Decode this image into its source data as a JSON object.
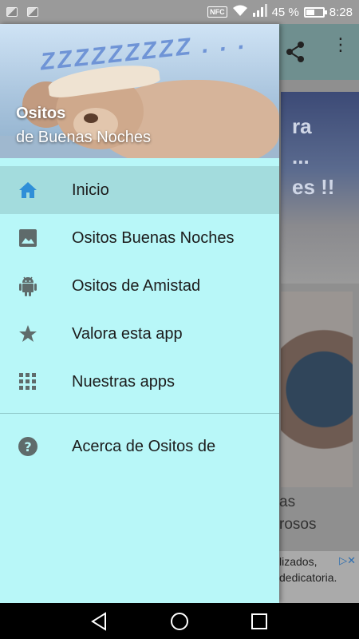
{
  "status_bar": {
    "nfc_label": "NFC",
    "battery_text": "45 %",
    "battery_level": 0.45,
    "time": "8:28"
  },
  "background_app": {
    "card1_text": "ra\n...\nes !!",
    "card2_text": "as\nrosos",
    "ad_text": "lizados,\ndedicatoria."
  },
  "drawer": {
    "header": {
      "title": "Ositos",
      "subtitle": "de Buenas Noches",
      "image_text": "ZZZZZZZZZ . . ."
    },
    "items": [
      {
        "label": "Inicio",
        "icon": "home-icon",
        "active": true
      },
      {
        "label": "Ositos Buenas Noches",
        "icon": "image-icon",
        "active": false
      },
      {
        "label": "Ositos de Amistad",
        "icon": "android-icon",
        "active": false
      },
      {
        "label": "Valora esta app",
        "icon": "star-icon",
        "active": false
      },
      {
        "label": "Nuestras apps",
        "icon": "apps-grid-icon",
        "active": false
      },
      {
        "label": "Acerca de Ositos de",
        "icon": "help-icon",
        "active": false
      }
    ]
  },
  "colors": {
    "drawer_background": "#b8f7f8",
    "active_item": "#a3dcdd",
    "active_icon": "#2f8fd8",
    "icon_gray": "#5f6b6b"
  },
  "nav_bar": {
    "buttons": [
      "back-icon",
      "home-circle-icon",
      "recents-icon"
    ]
  }
}
